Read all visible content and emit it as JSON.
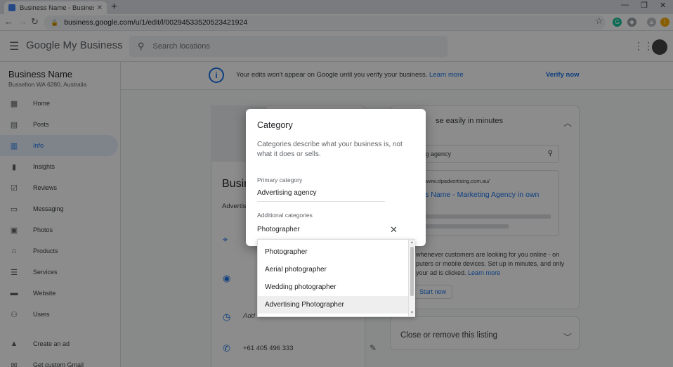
{
  "browser": {
    "tab_title": "Business Name - Business Info",
    "url": "business.google.com/u/1/edit/l/00294533520523421924"
  },
  "header": {
    "logo": "Google My Business",
    "search_placeholder": "Search locations"
  },
  "sidebar": {
    "business_name": "Business Name",
    "business_address": "Busselton WA 6280, Australia",
    "items": [
      {
        "label": "Home",
        "icon": "grid"
      },
      {
        "label": "Posts",
        "icon": "posts"
      },
      {
        "label": "Info",
        "icon": "store",
        "active": true
      },
      {
        "label": "Insights",
        "icon": "bar-chart"
      },
      {
        "label": "Reviews",
        "icon": "review"
      },
      {
        "label": "Messaging",
        "icon": "chat"
      },
      {
        "label": "Photos",
        "icon": "photos"
      },
      {
        "label": "Products",
        "icon": "basket"
      },
      {
        "label": "Services",
        "icon": "list"
      },
      {
        "label": "Website",
        "icon": "web"
      },
      {
        "label": "Users",
        "icon": "add-user"
      },
      {
        "label": "Create an ad",
        "icon": "ads"
      },
      {
        "label": "Get custom Gmail",
        "icon": "mail"
      }
    ]
  },
  "banner": {
    "message": "Your edits won't appear on Google until you verify your business.",
    "learn_more": "Learn more",
    "verify": "Verify now"
  },
  "info_card": {
    "title": "Busin",
    "category_snippet": "Advertis",
    "add_hours": "Add",
    "phone": "+61 405 496 333"
  },
  "right_panel": {
    "title": "se easily in minutes",
    "search_value": "dvertising agency",
    "preview_url": "p://www.clpadvertising.com.au/",
    "preview_link": "ess Name - Marketing Agency in own",
    "desc_line1": "whenever customers are looking for you online - on",
    "desc_line2": "puters or mobile devices. Set up in minutes, and only",
    "desc_line3": "your ad is clicked.",
    "desc_link": "Learn more",
    "start_now": "Start now",
    "close_listing": "Close or remove this listing"
  },
  "dialog": {
    "title": "Category",
    "description": "Categories describe what your business is, not what it does or sells.",
    "primary_label": "Primary category",
    "primary_value": "Advertising agency",
    "additional_label": "Additional categories",
    "additional_value": "Photographer"
  },
  "suggestions": [
    "Photographer",
    "Aerial photographer",
    "Wedding photographer",
    "Advertising Photographer"
  ]
}
